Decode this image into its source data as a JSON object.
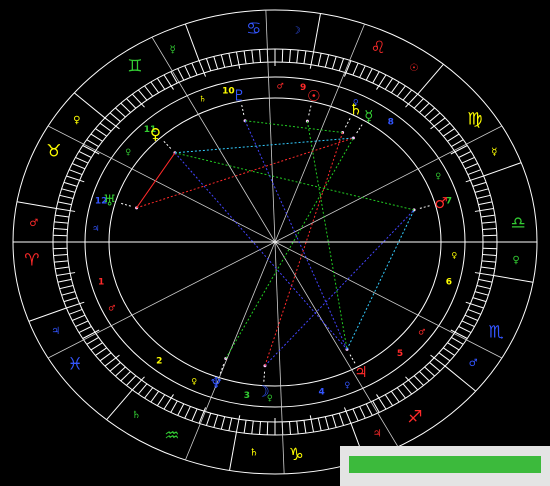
{
  "colors": {
    "background": "#000000",
    "line": "#ffffff",
    "fire": "#ff2a2a",
    "earth": "#ffff00",
    "air": "#33cc33",
    "water": "#3355ff",
    "aspect_red": "#ff2a2a",
    "aspect_blue": "#4444ff",
    "aspect_green": "#22cc22",
    "aspect_cyan": "#33ccff"
  },
  "signs": [
    {
      "name": "aries",
      "glyph": "♈",
      "element": "fire"
    },
    {
      "name": "taurus",
      "glyph": "♉",
      "element": "earth"
    },
    {
      "name": "gemini",
      "glyph": "♊",
      "element": "air"
    },
    {
      "name": "cancer",
      "glyph": "♋",
      "element": "water"
    },
    {
      "name": "leo",
      "glyph": "♌",
      "element": "fire"
    },
    {
      "name": "virgo",
      "glyph": "♍",
      "element": "earth"
    },
    {
      "name": "libra",
      "glyph": "♎",
      "element": "air"
    },
    {
      "name": "scorpio",
      "glyph": "♏",
      "element": "water"
    },
    {
      "name": "sagittarius",
      "glyph": "♐",
      "element": "fire"
    },
    {
      "name": "capricorn",
      "glyph": "♑",
      "element": "earth"
    },
    {
      "name": "aquarius",
      "glyph": "♒",
      "element": "air"
    },
    {
      "name": "pisces",
      "glyph": "♓",
      "element": "water"
    }
  ],
  "sign_rulers": [
    "♂",
    "♀",
    "☿",
    "☽",
    "☉",
    "☿",
    "♀",
    "♂",
    "♃",
    "♄",
    "♄",
    "♃"
  ],
  "houses": [
    "1",
    "2",
    "3",
    "4",
    "5",
    "6",
    "7",
    "8",
    "9",
    "10",
    "11",
    "12"
  ],
  "house_rulers": [
    "♂",
    "♀",
    "♀",
    "♀",
    "♂",
    "♀",
    "♀",
    "♀",
    "♂",
    "♄",
    "♀",
    "♃"
  ],
  "planets": [
    {
      "name": "sun",
      "glyph": "☉",
      "element": "fire"
    },
    {
      "name": "saturn",
      "glyph": "♄",
      "element": "earth"
    },
    {
      "name": "mercury",
      "glyph": "☿",
      "element": "air"
    },
    {
      "name": "mars",
      "glyph": "♂",
      "element": "fire"
    },
    {
      "name": "jupiter",
      "glyph": "♃",
      "element": "fire"
    },
    {
      "name": "neptune",
      "glyph": "♆",
      "element": "water"
    },
    {
      "name": "uranus",
      "glyph": "♅",
      "element": "air"
    },
    {
      "name": "venus",
      "glyph": "♀",
      "element": "earth"
    },
    {
      "name": "pluto",
      "glyph": "♇",
      "element": "water"
    },
    {
      "name": "moon",
      "glyph": "☽",
      "element": "water"
    }
  ],
  "aspects": [
    {
      "from": "venus",
      "to": "uranus",
      "color": "aspect_red"
    },
    {
      "from": "venus",
      "to": "mercury",
      "color": "aspect_cyan"
    },
    {
      "from": "venus",
      "to": "mars",
      "color": "aspect_green"
    },
    {
      "from": "venus",
      "to": "jupiter",
      "color": "aspect_blue"
    },
    {
      "from": "saturn",
      "to": "pluto",
      "color": "aspect_green"
    },
    {
      "from": "sun",
      "to": "jupiter",
      "color": "aspect_green"
    },
    {
      "from": "jupiter",
      "to": "mars",
      "color": "aspect_cyan"
    },
    {
      "from": "uranus",
      "to": "mercury",
      "color": "aspect_red"
    },
    {
      "from": "neptune",
      "to": "mercury",
      "color": "aspect_green"
    },
    {
      "from": "moon",
      "to": "mars",
      "color": "aspect_blue"
    },
    {
      "from": "moon",
      "to": "saturn",
      "color": "aspect_red"
    },
    {
      "from": "pluto",
      "to": "jupiter",
      "color": "aspect_blue"
    }
  ]
}
